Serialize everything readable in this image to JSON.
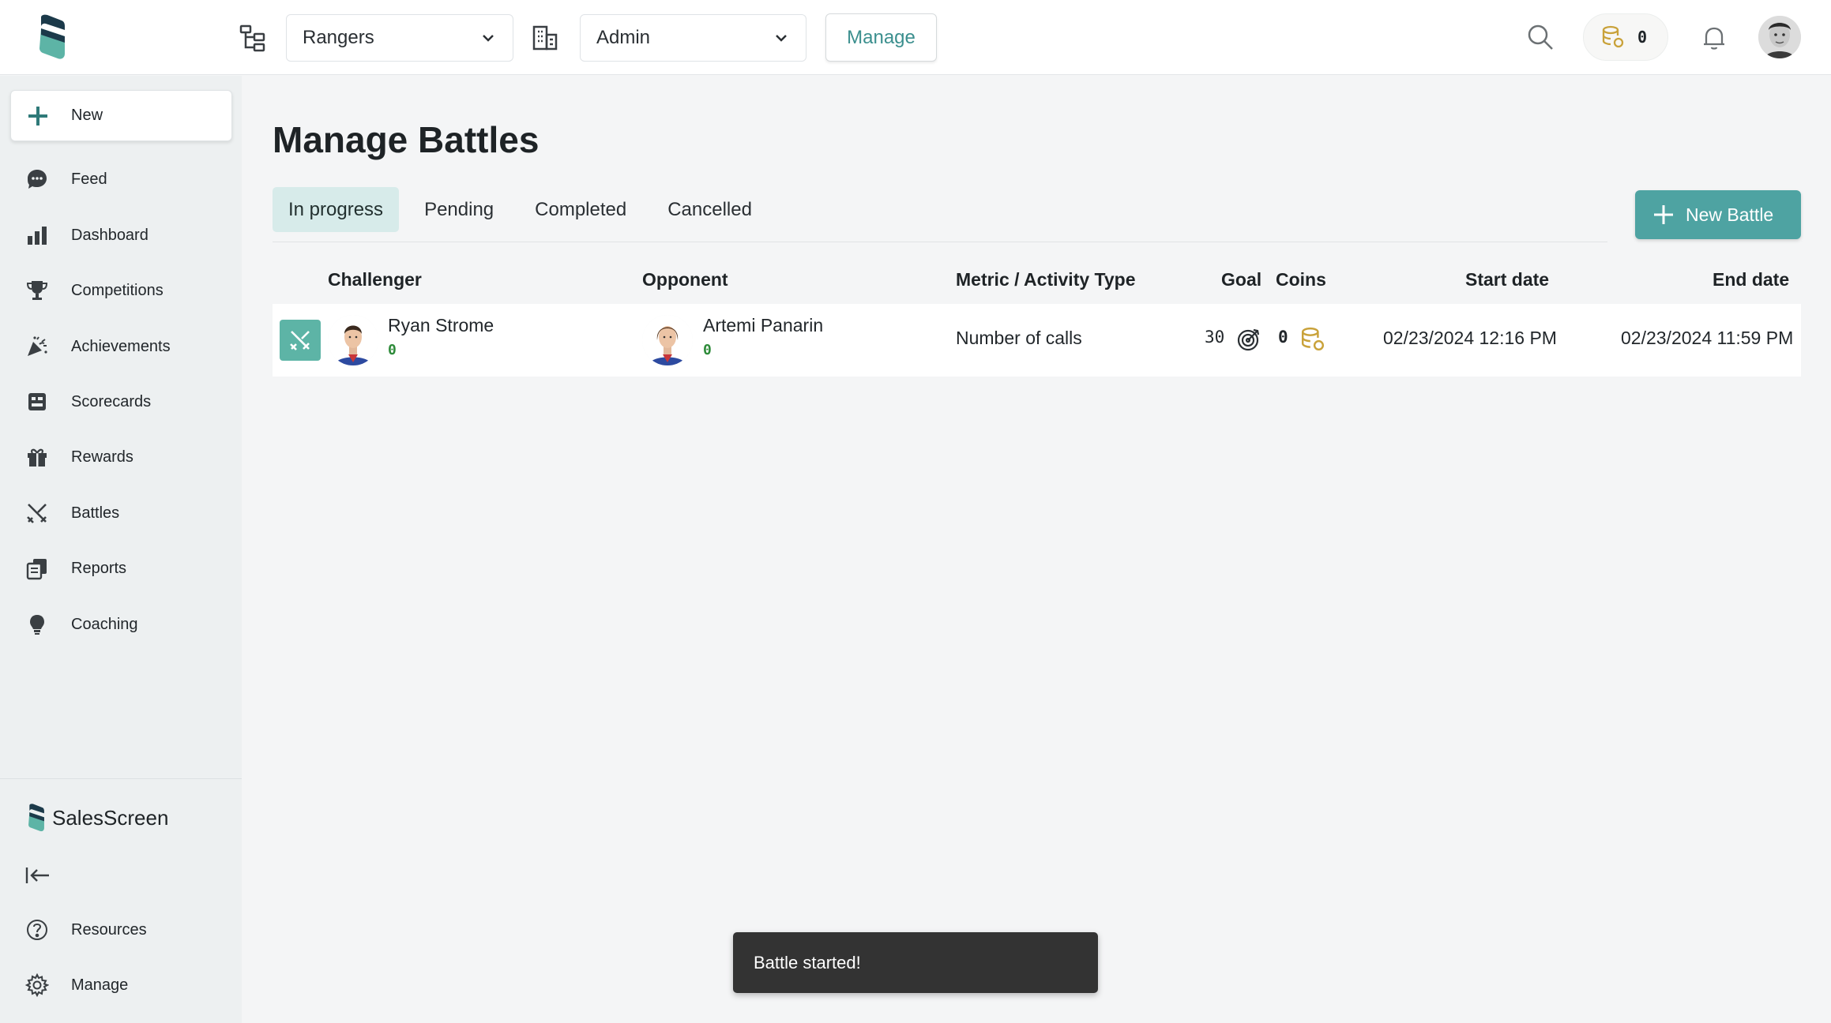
{
  "header": {
    "team_select": "Rangers",
    "role_select": "Admin",
    "manage_label": "Manage",
    "coin_count": "0",
    "colors": {
      "accent": "#4ea3a2",
      "coin": "#c9a23a"
    }
  },
  "sidebar": {
    "new_label": "New",
    "items": [
      {
        "label": "Feed",
        "icon": "chat-bubble-icon"
      },
      {
        "label": "Dashboard",
        "icon": "bar-chart-icon"
      },
      {
        "label": "Competitions",
        "icon": "trophy-icon"
      },
      {
        "label": "Achievements",
        "icon": "party-popper-icon"
      },
      {
        "label": "Scorecards",
        "icon": "scorecard-icon"
      },
      {
        "label": "Rewards",
        "icon": "gift-icon"
      },
      {
        "label": "Battles",
        "icon": "crossed-swords-icon"
      },
      {
        "label": "Reports",
        "icon": "reports-icon"
      },
      {
        "label": "Coaching",
        "icon": "lightbulb-icon"
      }
    ],
    "brand": "SalesScreen",
    "footer": [
      {
        "label": "Resources",
        "icon": "help-circle-icon"
      },
      {
        "label": "Manage",
        "icon": "gear-icon"
      }
    ]
  },
  "main": {
    "title": "Manage Battles",
    "tabs": [
      {
        "label": "In progress",
        "active": true
      },
      {
        "label": "Pending",
        "active": false
      },
      {
        "label": "Completed",
        "active": false
      },
      {
        "label": "Cancelled",
        "active": false
      }
    ],
    "new_battle_label": "New Battle",
    "table": {
      "columns": [
        "Challenger",
        "Opponent",
        "Metric / Activity Type",
        "Goal",
        "Coins",
        "Start date",
        "End date"
      ],
      "rows": [
        {
          "challenger": {
            "name": "Ryan Strome",
            "score": "0"
          },
          "opponent": {
            "name": "Artemi Panarin",
            "score": "0"
          },
          "metric": "Number of calls",
          "goal": "30",
          "coins": "0",
          "start": "02/23/2024 12:16 PM",
          "end": "02/23/2024 11:59 PM"
        }
      ]
    }
  },
  "toast": "Battle started!"
}
